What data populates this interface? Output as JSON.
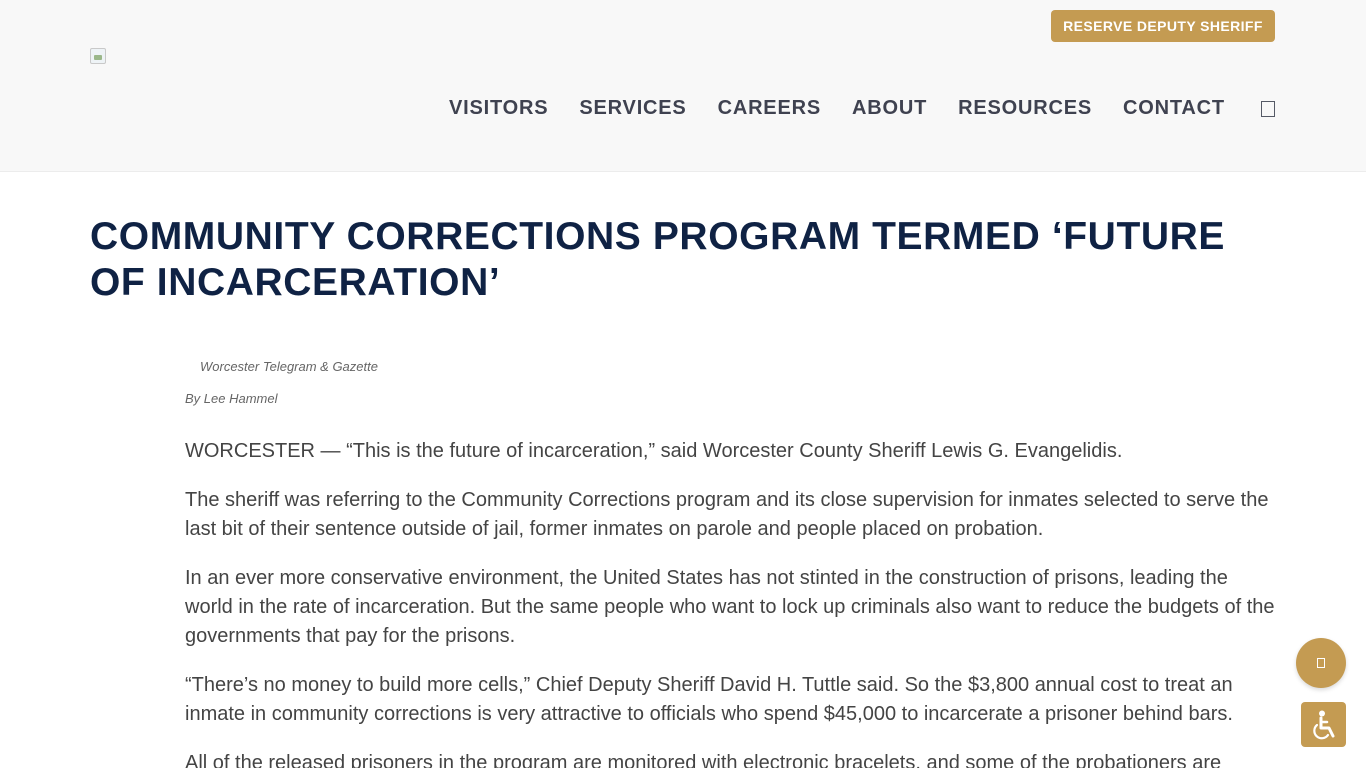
{
  "header": {
    "logo_icon": "broken-image-icon",
    "reserve_button_label": "RESERVE DEPUTY SHERIFF",
    "nav": [
      {
        "label": "VISITORS"
      },
      {
        "label": "SERVICES"
      },
      {
        "label": "CAREERS"
      },
      {
        "label": "ABOUT"
      },
      {
        "label": "RESOURCES"
      },
      {
        "label": "CONTACT"
      }
    ],
    "search_icon": "search-icon"
  },
  "article": {
    "title": "COMMUNITY CORRECTIONS PROGRAM TERMED ‘FUTURE OF INCARCERATION’",
    "source": "Worcester Telegram & Gazette",
    "byline": "By Lee Hammel",
    "paragraphs": [
      "WORCESTER — “This is the future of incarceration,” said Worcester County Sheriff Lewis G. Evangelidis.",
      "The sheriff was referring to the Community Corrections program and its close supervision for inmates selected to serve the last bit of their sentence outside of jail, former inmates on parole and people placed on probation.",
      "In an ever more conservative environment, the United States has not stinted in the construction of prisons, leading the world in the rate of incarceration. But the same people who want to lock up criminals also want to reduce the budgets of the governments that pay for the prisons.",
      "“There’s no money to build more cells,” Chief Deputy Sheriff David H. Tuttle said. So the $3,800 annual cost to treat an inmate in community corrections is very attractive to officials who spend $45,000 to incarcerate a prisoner behind bars.",
      "All of the released prisoners in the program are monitored with electronic bracelets, and some of the probationers are"
    ]
  },
  "floating": {
    "action_icon": "chat-icon",
    "accessibility_icon": "accessibility-icon"
  },
  "colors": {
    "accent": "#c49b52",
    "title": "#0f2244",
    "nav_text": "#3f4250",
    "header_bg": "#f8f8f8"
  }
}
